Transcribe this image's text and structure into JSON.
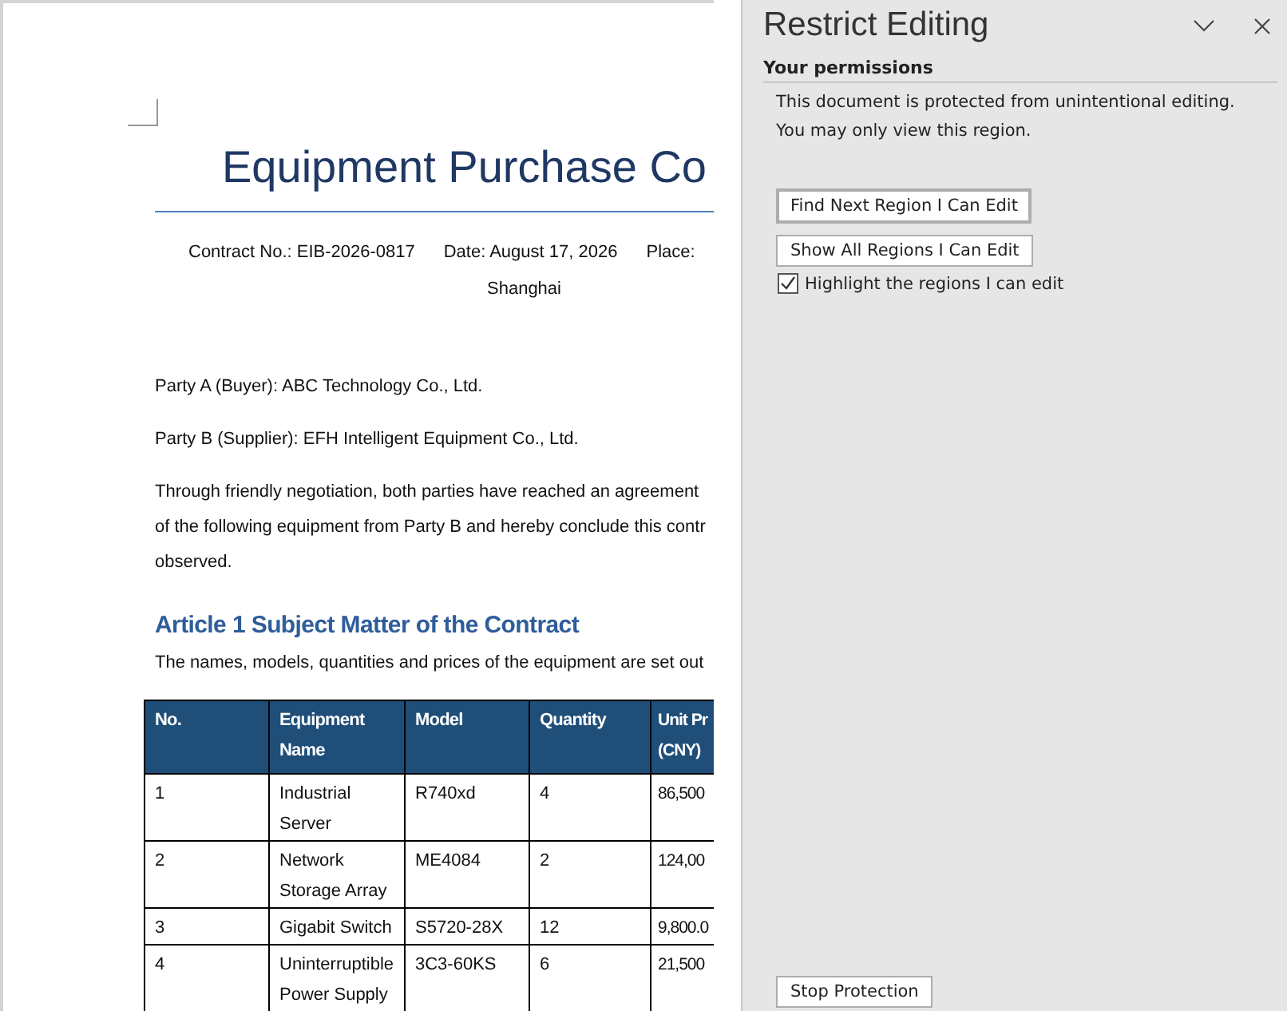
{
  "document": {
    "title": "Equipment Purchase Co",
    "meta": [
      "Contract No.: EIB-2026-0817",
      "Date: August 17, 2026",
      "Place:"
    ],
    "meta_line_2": "Shanghai",
    "paragraphs": [
      [
        "Party A (Buyer): ABC Technology Co., Ltd."
      ],
      [
        "Party B (Supplier): EFH Intelligent Equipment Co., Ltd."
      ],
      [
        "Through friendly negotiation, both parties have reached an agreement",
        "of the following equipment from Party B and hereby conclude this contr",
        "observed."
      ]
    ],
    "heading": "Article 1  Subject Matter of the Contract",
    "intro": "The names, models, quantities and prices of the equipment are set out",
    "table": {
      "columns": [
        "No.",
        "Equipment Name",
        "Model",
        "Quantity",
        "Unit Pr (CNY)"
      ],
      "rows": [
        [
          "1",
          "Industrial Server",
          "R740xd",
          "4",
          "86,500"
        ],
        [
          "2",
          "Network Storage Array",
          "ME4084",
          "2",
          "124,00"
        ],
        [
          "3",
          "Gigabit Switch",
          "S5720-28X",
          "12",
          "9,800.0"
        ],
        [
          "4",
          "Uninterruptible Power Supply",
          "3C3-60KS",
          "6",
          "21,500"
        ]
      ]
    }
  },
  "pane": {
    "title": "Restrict Editing",
    "section": "Your permissions",
    "messages": [
      "This document is protected from unintentional editing.",
      "You may only view this region."
    ],
    "buttons": [
      {
        "label": "Find Next Region I Can Edit",
        "default": true
      },
      {
        "label": "Show All Regions I Can Edit",
        "default": false
      }
    ],
    "highlight": {
      "label": "Highlight the regions I can edit",
      "checked": true
    },
    "stop_button": "Stop Protection"
  }
}
